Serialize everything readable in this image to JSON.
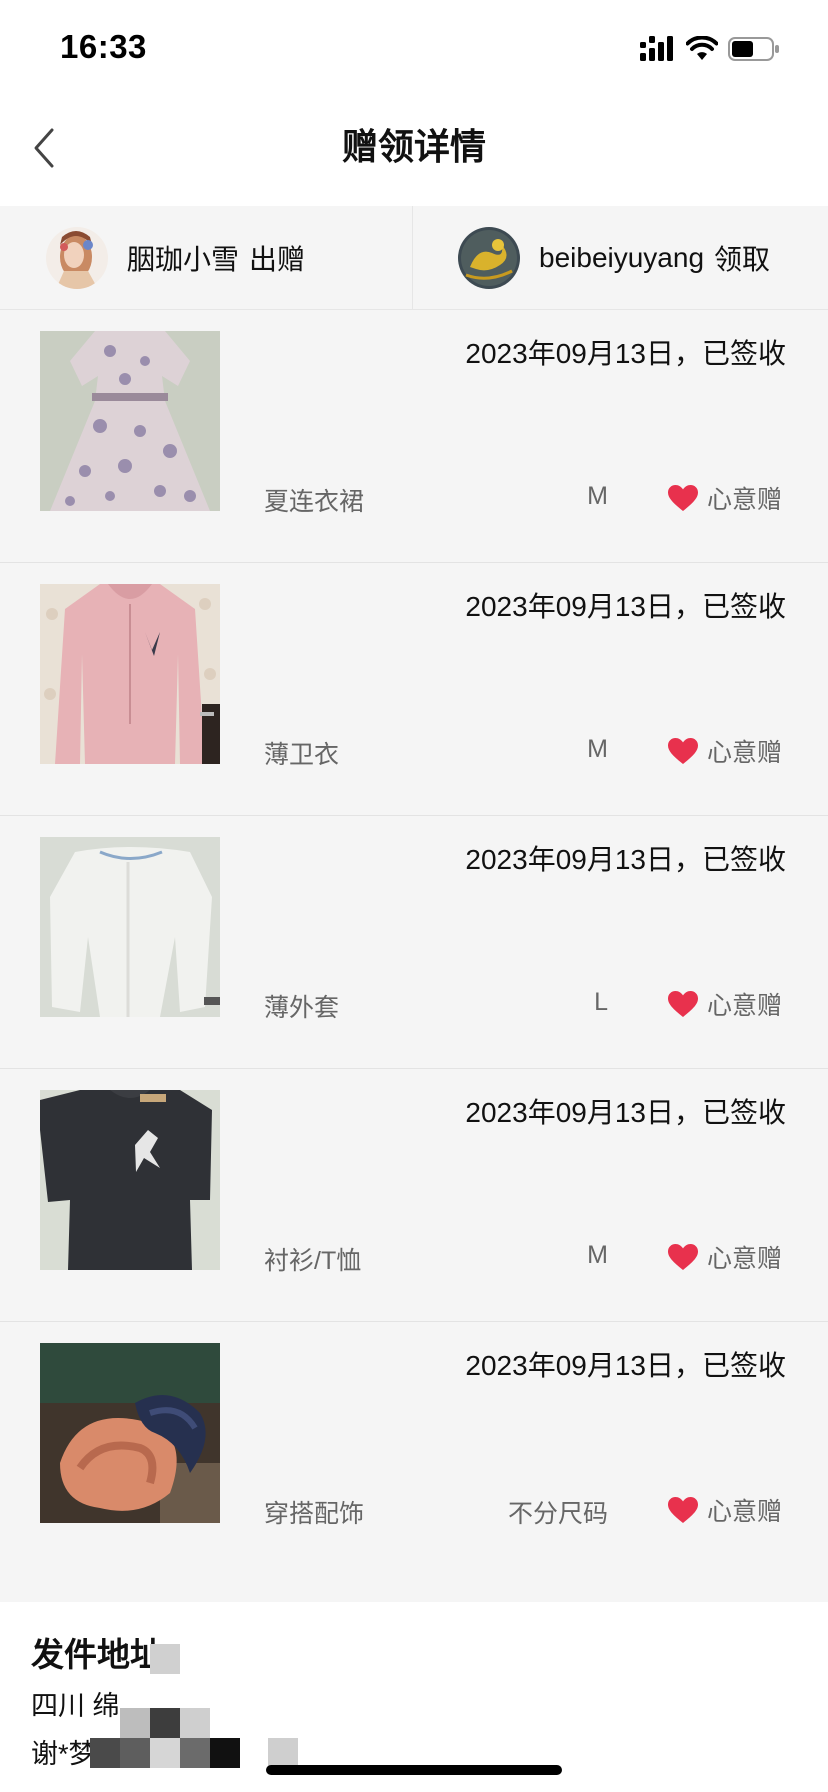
{
  "status_bar": {
    "time": "16:33",
    "signal_icon": "signal-bars-icon",
    "wifi_icon": "wifi-icon",
    "battery_icon": "battery-icon",
    "battery_level": 0.55
  },
  "nav": {
    "back_icon": "chevron-left-icon",
    "title": "赠领详情"
  },
  "giver": {
    "name": "胭珈小雪",
    "role": "出赠"
  },
  "receiver": {
    "name": "beibeiyuyang",
    "role": "领取"
  },
  "items": [
    {
      "status": "2023年09月13日，已签收",
      "name": "夏连衣裙",
      "size": "M",
      "tag": "心意赠",
      "thumb": "floral-dress-photo"
    },
    {
      "status": "2023年09月13日，已签收",
      "name": "薄卫衣",
      "size": "M",
      "tag": "心意赠",
      "thumb": "pink-hoodie-photo"
    },
    {
      "status": "2023年09月13日，已签收",
      "name": "薄外套",
      "size": "L",
      "tag": "心意赠",
      "thumb": "white-cardigan-photo"
    },
    {
      "status": "2023年09月13日，已签收",
      "name": "衬衫/T恤",
      "size": "M",
      "tag": "心意赠",
      "thumb": "black-tshirt-photo"
    },
    {
      "status": "2023年09月13日，已签收",
      "name": "穿搭配饰",
      "size": "不分尺码",
      "tag": "心意赠",
      "thumb": "hair-clips-photo"
    }
  ],
  "address": {
    "title": "发件地址",
    "line1": "四川 绵",
    "line2": "谢*梦"
  },
  "colors": {
    "heart": "#e8314d",
    "page_background": "#f5f5f5",
    "header_background": "#ffffff"
  }
}
